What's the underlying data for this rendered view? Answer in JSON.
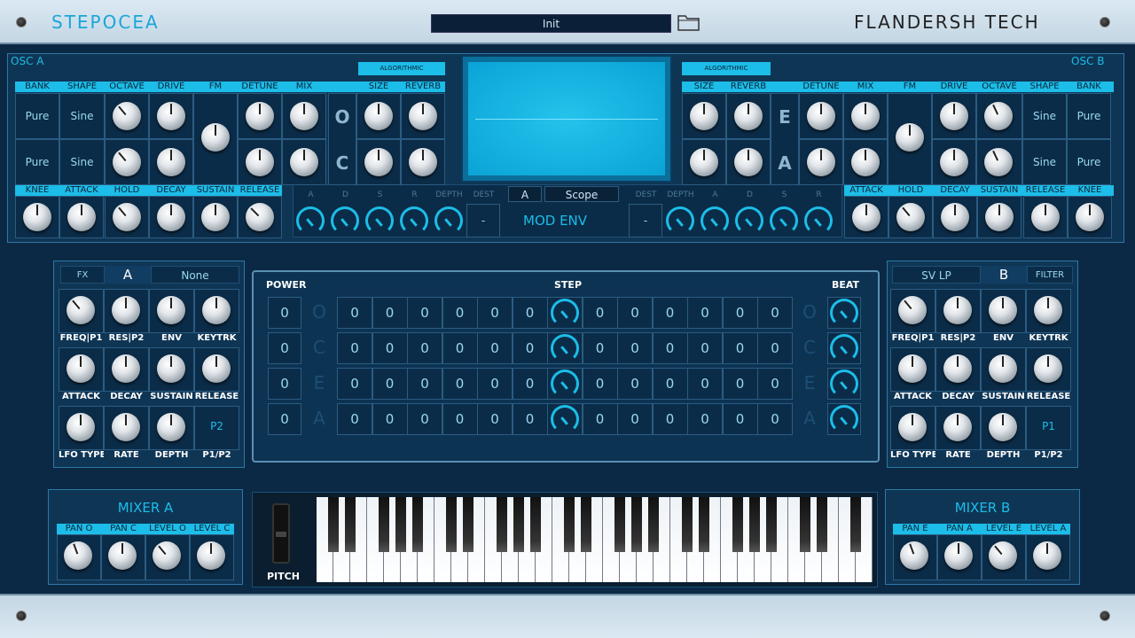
{
  "header": {
    "title": "STEPOCEA",
    "brand": "FLANDERSH TECH",
    "preset": "Init"
  },
  "oscA": {
    "label": "OSC A",
    "algo": "ALGORITHMIC",
    "top_headers": [
      "BANK",
      "SHAPE",
      "OCTAVE",
      "DRIVE",
      "FM",
      "DETUNE",
      "MIX",
      "SIZE",
      "REVERB"
    ],
    "rows": [
      {
        "bank": "Pure",
        "shape": "Sine"
      },
      {
        "bank": "Pure",
        "shape": "Sine"
      }
    ],
    "letters": [
      "O",
      "C"
    ],
    "env_headers": [
      "KNEE",
      "ATTACK",
      "HOLD",
      "DECAY",
      "SUSTAIN",
      "RELEASE"
    ]
  },
  "oscB": {
    "label": "OSC B",
    "algo": "ALGORITHMIC",
    "top_headers": [
      "SIZE",
      "REVERB",
      "DETUNE",
      "MIX",
      "FM",
      "DRIVE",
      "OCTAVE",
      "SHAPE",
      "BANK"
    ],
    "rows": [
      {
        "bank": "Pure",
        "shape": "Sine"
      },
      {
        "bank": "Pure",
        "shape": "Sine"
      }
    ],
    "letters": [
      "E",
      "A"
    ],
    "env_headers": [
      "ATTACK",
      "HOLD",
      "DECAY",
      "SUSTAIN",
      "RELEASE",
      "KNEE"
    ]
  },
  "modenv": {
    "left_labels": [
      "A",
      "D",
      "S",
      "R",
      "DEPTH",
      "DEST"
    ],
    "right_labels": [
      "DEST",
      "DEPTH",
      "A",
      "D",
      "S",
      "R"
    ],
    "dest_value": "-",
    "title": "MOD ENV",
    "sel": "A",
    "scope": "Scope"
  },
  "fxA": {
    "fx": "FX",
    "sel": "A",
    "type": "None",
    "labels": [
      "FREQ|P1",
      "RES|P2",
      "ENV",
      "KEYTRK",
      "ATTACK",
      "DECAY",
      "SUSTAIN",
      "RELEASE",
      "LFO TYPE",
      "RATE",
      "DEPTH",
      "P1/P2"
    ],
    "p": "P2"
  },
  "fxB": {
    "fx": "FILTER",
    "sel": "B",
    "type": "SV LP",
    "labels": [
      "FREQ|P1",
      "RES|P2",
      "ENV",
      "KEYTRK",
      "ATTACK",
      "DECAY",
      "SUSTAIN",
      "RELEASE",
      "LFO TYPE",
      "RATE",
      "DEPTH",
      "P1/P2"
    ],
    "p": "P1"
  },
  "step": {
    "power": "POWER",
    "step": "STEP",
    "beat": "BEAT",
    "power_vals": [
      "0",
      "0",
      "0",
      "0"
    ],
    "letters": [
      "O",
      "C",
      "E",
      "A"
    ],
    "cell": "0"
  },
  "mixerA": {
    "title": "MIXER A",
    "labels": [
      "PAN O",
      "PAN C",
      "LEVEL O",
      "LEVEL C"
    ]
  },
  "mixerB": {
    "title": "MIXER B",
    "labels": [
      "PAN E",
      "PAN A",
      "LEVEL E",
      "LEVEL A"
    ]
  },
  "pitch": "PITCH"
}
